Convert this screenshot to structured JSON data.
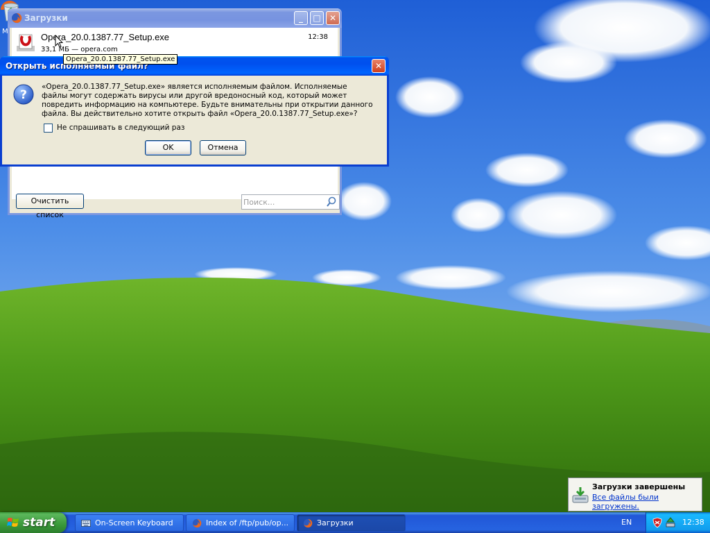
{
  "desktop": {
    "partial_icon_letter": "M"
  },
  "downloads_window": {
    "title": "Загрузки",
    "item": {
      "filename": "Opera_20.0.1387.77_Setup.exe",
      "time": "12:38",
      "meta": "33,1 МБ — opera.com",
      "tooltip": "Opera_20.0.1387.77_Setup.exe",
      "icon": "opera-icon"
    },
    "clear_list_label": "Очистить список",
    "search_placeholder": "Поиск..."
  },
  "confirm_dialog": {
    "title": "Открыть исполняемый файл?",
    "message": "«Opera_20.0.1387.77_Setup.exe» является исполняемым файлом. Исполняемые файлы могут содержать вирусы или другой вредоносный код, который может повредить информацию на компьютере. Будьте внимательны при открытии данного файла. Вы действительно хотите открыть файл «Opera_20.0.1387.77_Setup.exe»?",
    "checkbox_label": "Не спрашивать в следующий раз",
    "checkbox_checked": false,
    "ok_label": "OK",
    "cancel_label": "Отмена",
    "icon": "question-icon"
  },
  "notification": {
    "title": "Загрузки завершены",
    "link": "Все файлы были загружены."
  },
  "taskbar": {
    "start_label": "start",
    "tasks": [
      {
        "label": "On-Screen Keyboard",
        "icon": "keyboard-icon",
        "active": false
      },
      {
        "label": "Index of /ftp/pub/op...",
        "icon": "firefox-icon",
        "active": false
      },
      {
        "label": "Загрузки",
        "icon": "firefox-icon",
        "active": true
      }
    ],
    "language": "EN",
    "clock": "12:38"
  },
  "colors": {
    "title_active": "#0050ee",
    "title_inactive": "#7b97e0",
    "start_green": "#3a993a",
    "taskbar_blue": "#2663e0",
    "window_face": "#ece9d8"
  }
}
